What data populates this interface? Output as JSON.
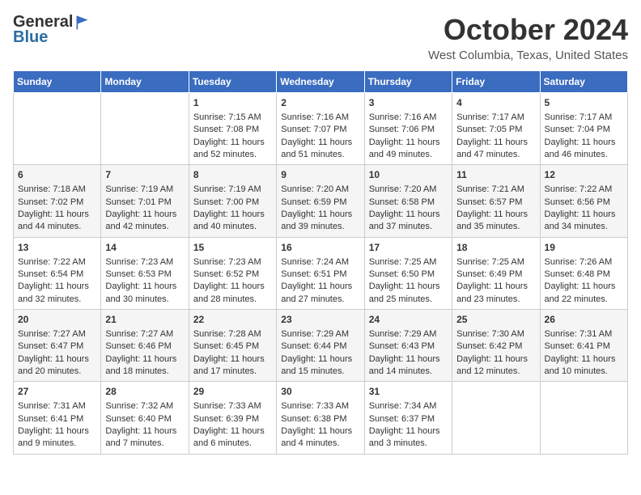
{
  "header": {
    "logo_general": "General",
    "logo_blue": "Blue",
    "month_title": "October 2024",
    "location": "West Columbia, Texas, United States"
  },
  "days_of_week": [
    "Sunday",
    "Monday",
    "Tuesday",
    "Wednesday",
    "Thursday",
    "Friday",
    "Saturday"
  ],
  "weeks": [
    [
      {
        "day": "",
        "sunrise": "",
        "sunset": "",
        "daylight": ""
      },
      {
        "day": "",
        "sunrise": "",
        "sunset": "",
        "daylight": ""
      },
      {
        "day": "1",
        "sunrise": "Sunrise: 7:15 AM",
        "sunset": "Sunset: 7:08 PM",
        "daylight": "Daylight: 11 hours and 52 minutes."
      },
      {
        "day": "2",
        "sunrise": "Sunrise: 7:16 AM",
        "sunset": "Sunset: 7:07 PM",
        "daylight": "Daylight: 11 hours and 51 minutes."
      },
      {
        "day": "3",
        "sunrise": "Sunrise: 7:16 AM",
        "sunset": "Sunset: 7:06 PM",
        "daylight": "Daylight: 11 hours and 49 minutes."
      },
      {
        "day": "4",
        "sunrise": "Sunrise: 7:17 AM",
        "sunset": "Sunset: 7:05 PM",
        "daylight": "Daylight: 11 hours and 47 minutes."
      },
      {
        "day": "5",
        "sunrise": "Sunrise: 7:17 AM",
        "sunset": "Sunset: 7:04 PM",
        "daylight": "Daylight: 11 hours and 46 minutes."
      }
    ],
    [
      {
        "day": "6",
        "sunrise": "Sunrise: 7:18 AM",
        "sunset": "Sunset: 7:02 PM",
        "daylight": "Daylight: 11 hours and 44 minutes."
      },
      {
        "day": "7",
        "sunrise": "Sunrise: 7:19 AM",
        "sunset": "Sunset: 7:01 PM",
        "daylight": "Daylight: 11 hours and 42 minutes."
      },
      {
        "day": "8",
        "sunrise": "Sunrise: 7:19 AM",
        "sunset": "Sunset: 7:00 PM",
        "daylight": "Daylight: 11 hours and 40 minutes."
      },
      {
        "day": "9",
        "sunrise": "Sunrise: 7:20 AM",
        "sunset": "Sunset: 6:59 PM",
        "daylight": "Daylight: 11 hours and 39 minutes."
      },
      {
        "day": "10",
        "sunrise": "Sunrise: 7:20 AM",
        "sunset": "Sunset: 6:58 PM",
        "daylight": "Daylight: 11 hours and 37 minutes."
      },
      {
        "day": "11",
        "sunrise": "Sunrise: 7:21 AM",
        "sunset": "Sunset: 6:57 PM",
        "daylight": "Daylight: 11 hours and 35 minutes."
      },
      {
        "day": "12",
        "sunrise": "Sunrise: 7:22 AM",
        "sunset": "Sunset: 6:56 PM",
        "daylight": "Daylight: 11 hours and 34 minutes."
      }
    ],
    [
      {
        "day": "13",
        "sunrise": "Sunrise: 7:22 AM",
        "sunset": "Sunset: 6:54 PM",
        "daylight": "Daylight: 11 hours and 32 minutes."
      },
      {
        "day": "14",
        "sunrise": "Sunrise: 7:23 AM",
        "sunset": "Sunset: 6:53 PM",
        "daylight": "Daylight: 11 hours and 30 minutes."
      },
      {
        "day": "15",
        "sunrise": "Sunrise: 7:23 AM",
        "sunset": "Sunset: 6:52 PM",
        "daylight": "Daylight: 11 hours and 28 minutes."
      },
      {
        "day": "16",
        "sunrise": "Sunrise: 7:24 AM",
        "sunset": "Sunset: 6:51 PM",
        "daylight": "Daylight: 11 hours and 27 minutes."
      },
      {
        "day": "17",
        "sunrise": "Sunrise: 7:25 AM",
        "sunset": "Sunset: 6:50 PM",
        "daylight": "Daylight: 11 hours and 25 minutes."
      },
      {
        "day": "18",
        "sunrise": "Sunrise: 7:25 AM",
        "sunset": "Sunset: 6:49 PM",
        "daylight": "Daylight: 11 hours and 23 minutes."
      },
      {
        "day": "19",
        "sunrise": "Sunrise: 7:26 AM",
        "sunset": "Sunset: 6:48 PM",
        "daylight": "Daylight: 11 hours and 22 minutes."
      }
    ],
    [
      {
        "day": "20",
        "sunrise": "Sunrise: 7:27 AM",
        "sunset": "Sunset: 6:47 PM",
        "daylight": "Daylight: 11 hours and 20 minutes."
      },
      {
        "day": "21",
        "sunrise": "Sunrise: 7:27 AM",
        "sunset": "Sunset: 6:46 PM",
        "daylight": "Daylight: 11 hours and 18 minutes."
      },
      {
        "day": "22",
        "sunrise": "Sunrise: 7:28 AM",
        "sunset": "Sunset: 6:45 PM",
        "daylight": "Daylight: 11 hours and 17 minutes."
      },
      {
        "day": "23",
        "sunrise": "Sunrise: 7:29 AM",
        "sunset": "Sunset: 6:44 PM",
        "daylight": "Daylight: 11 hours and 15 minutes."
      },
      {
        "day": "24",
        "sunrise": "Sunrise: 7:29 AM",
        "sunset": "Sunset: 6:43 PM",
        "daylight": "Daylight: 11 hours and 14 minutes."
      },
      {
        "day": "25",
        "sunrise": "Sunrise: 7:30 AM",
        "sunset": "Sunset: 6:42 PM",
        "daylight": "Daylight: 11 hours and 12 minutes."
      },
      {
        "day": "26",
        "sunrise": "Sunrise: 7:31 AM",
        "sunset": "Sunset: 6:41 PM",
        "daylight": "Daylight: 11 hours and 10 minutes."
      }
    ],
    [
      {
        "day": "27",
        "sunrise": "Sunrise: 7:31 AM",
        "sunset": "Sunset: 6:41 PM",
        "daylight": "Daylight: 11 hours and 9 minutes."
      },
      {
        "day": "28",
        "sunrise": "Sunrise: 7:32 AM",
        "sunset": "Sunset: 6:40 PM",
        "daylight": "Daylight: 11 hours and 7 minutes."
      },
      {
        "day": "29",
        "sunrise": "Sunrise: 7:33 AM",
        "sunset": "Sunset: 6:39 PM",
        "daylight": "Daylight: 11 hours and 6 minutes."
      },
      {
        "day": "30",
        "sunrise": "Sunrise: 7:33 AM",
        "sunset": "Sunset: 6:38 PM",
        "daylight": "Daylight: 11 hours and 4 minutes."
      },
      {
        "day": "31",
        "sunrise": "Sunrise: 7:34 AM",
        "sunset": "Sunset: 6:37 PM",
        "daylight": "Daylight: 11 hours and 3 minutes."
      },
      {
        "day": "",
        "sunrise": "",
        "sunset": "",
        "daylight": ""
      },
      {
        "day": "",
        "sunrise": "",
        "sunset": "",
        "daylight": ""
      }
    ]
  ]
}
